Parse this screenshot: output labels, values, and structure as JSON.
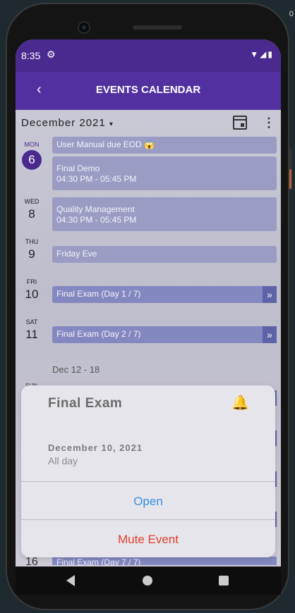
{
  "status": {
    "time": "8:35",
    "settings_icon": "gear-icon",
    "icons": "wifi-icon signal-icon battery-icon"
  },
  "appbar": {
    "title": "EVENTS CALENDAR",
    "back_icon": "back-chevron-icon"
  },
  "device": {
    "corner_text": "0"
  },
  "header": {
    "month": "December 2021"
  },
  "days": [
    {
      "dow": "MON",
      "num": "6"
    },
    {
      "dow": "WED",
      "num": "8"
    },
    {
      "dow": "THU",
      "num": "9"
    },
    {
      "dow": "FRI",
      "num": "10"
    },
    {
      "dow": "SAT",
      "num": "11"
    }
  ],
  "events": [
    {
      "title": "User Manual due EOD 😱",
      "time": ""
    },
    {
      "title": "Final Demo",
      "time": "04:30 PM - 05:45 PM"
    },
    {
      "title": "Quality Management",
      "time": "04:30 PM - 05:45 PM"
    },
    {
      "title": "Friday Eve",
      "time": ""
    },
    {
      "title": "Final Exam (Day 1 / 7)",
      "time": ""
    },
    {
      "title": "Final Exam (Day 2 / 7)",
      "time": ""
    }
  ],
  "week_label": "Dec 12 - 18",
  "peek": {
    "sun_label": "SUN",
    "bottom_num": "16",
    "bottom_event": "Final Exam (Day 7 / 7)"
  },
  "dialog": {
    "title": "Final Exam",
    "date": "December 10, 2021",
    "subtitle": "All day",
    "open_label": "Open",
    "mute_label": "Mute Event"
  },
  "colors": {
    "primary": "#5330a0",
    "statusbar": "#4a2a8f",
    "event": "#9a9cc4",
    "open": "#3a8fe0",
    "mute": "#e0402a"
  }
}
